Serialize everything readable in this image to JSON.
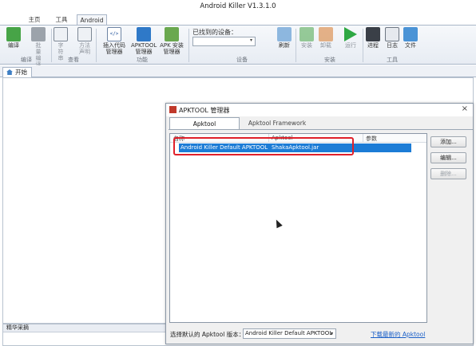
{
  "app": {
    "title": "Android Killer V1.3.1.0"
  },
  "ribbon_tabs": [
    "主页",
    "工具",
    "Android"
  ],
  "ribbon": {
    "compile_group": {
      "buttons": [
        "编译",
        "批量编译"
      ],
      "label": "编译"
    },
    "view_group": {
      "buttons": [
        "字符串",
        "方法声明"
      ],
      "label": "查看"
    },
    "function_group": {
      "buttons": [
        "插入代码管理器",
        "APKTOOL管理器",
        "APK 安装管理器"
      ],
      "label": "功能"
    },
    "device_group": {
      "found_label": "已找到的设备：",
      "device_value": "",
      "refresh": "刷新",
      "label": "设备"
    },
    "install_group": {
      "buttons": [
        "安装",
        "卸载",
        "运行"
      ],
      "label": "安装"
    },
    "tools_group": {
      "buttons": [
        "进程",
        "日志",
        "文件"
      ],
      "label": "工具"
    }
  },
  "doc_tab": {
    "label": "开始"
  },
  "status_panel": {
    "title": "精华采摘"
  },
  "dialog": {
    "title": "APKTOOL 管理器",
    "tabs": [
      "Apktool",
      "Apktool Framework"
    ],
    "columns": [
      "名称",
      "Apktool",
      "参数"
    ],
    "rows": [
      {
        "name": "Android Killer Default APKTOOL",
        "apktool": "ShakaApktool.jar",
        "params": ""
      }
    ],
    "buttons": {
      "add": "添加...",
      "edit": "编辑...",
      "delete": "删除..."
    },
    "footer": {
      "select_label": "选择默认的 Apktool 版本：",
      "selected": "Android Killer Default APKTOOL",
      "download_link": "下载最新的 Apktool"
    }
  },
  "colors": {
    "accent": "#1c7cd6",
    "highlight_box": "#e0202a"
  }
}
